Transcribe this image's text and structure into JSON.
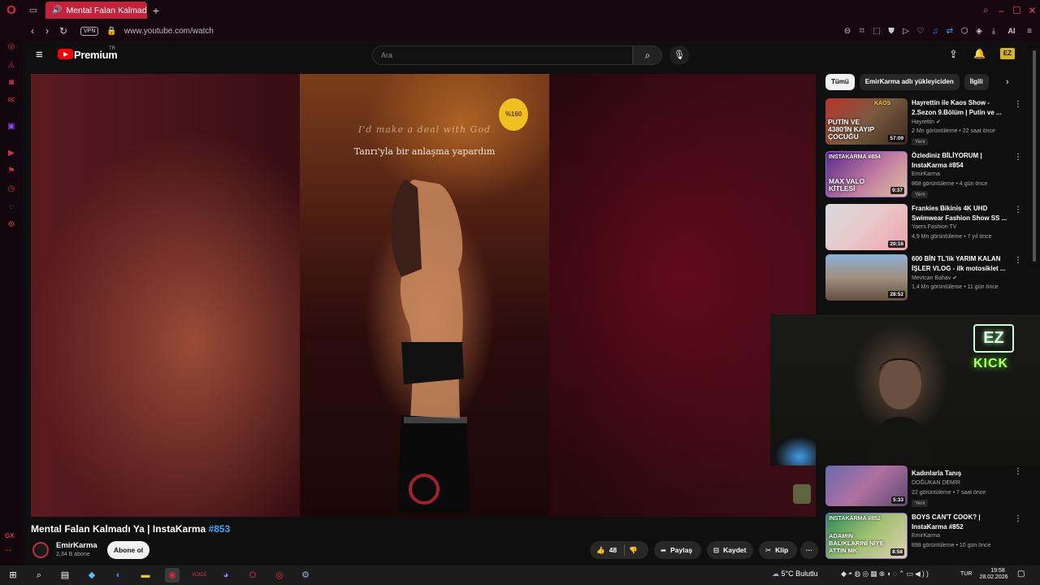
{
  "browser": {
    "tab_title": "Mental Falan Kalmadı Y",
    "url": "www.youtube.com/watch",
    "vpn_label": "VPN",
    "ai_label": "AI",
    "accent": "#c4213a"
  },
  "youtube": {
    "brand": "Premium",
    "brand_region": "TR",
    "search_placeholder": "Ara"
  },
  "video": {
    "lyric_en": "I'd make a deal with God",
    "lyric_tr": "Tanrı'yla bir anlaşma yapardım",
    "logo_badge": "%160",
    "title": "Mental Falan Kalmadı Ya | InstaKarma ",
    "hashtag": "#853",
    "channel": "EmirKarma",
    "subscribers": "2,34 B abone",
    "subscribe_label": "Abone ol",
    "likes": "48",
    "share_label": "Paylaş",
    "save_label": "Kaydet",
    "clip_label": "Klip"
  },
  "chips": [
    "Tümü",
    "EmirKarma adlı yükleyiciden",
    "İlgili"
  ],
  "recommendations": [
    {
      "title": "Hayrettin ile Kaos Show - 2.Sezon 9.Bölüm | Putin ve ...",
      "channel": "Hayrettin",
      "meta": "2 Mn görüntüleme • 22 saat önce",
      "new": "Yeni",
      "duration": "57:09",
      "thumb_top": "KAOS",
      "thumb_big": "PUTİN VE 4380'İN KAYIP ÇOCUĞU"
    },
    {
      "title": "Özlediniz BİLİYORUM | InstaKarma #854",
      "channel": "EmirKarma",
      "meta": "868 görüntüleme • 4 gün önce",
      "new": "Yeni",
      "duration": "9:37",
      "thumb_top": "INSTAKARMA #854",
      "thumb_big": "MAX VALO KİTLESİ"
    },
    {
      "title": "Frankies Bikinis 4K UHD Swimwear Fashion Show SS ...",
      "channel": "Yaers Fashion TV",
      "meta": "4,9 Mn görüntüleme • 7 yıl önce",
      "new": "",
      "duration": "20:16",
      "thumb_top": "",
      "thumb_big": ""
    },
    {
      "title": "600 BİN TL'lik YARIM KALAN İŞLER VLOG - ilk motosiklet ...",
      "channel": "Mevtcan Bahav",
      "meta": "1,4 Mn görüntüleme • 11 gün önce",
      "new": "",
      "duration": "28:52",
      "thumb_top": "",
      "thumb_big": ""
    },
    {
      "title": "Kadınlarla Tanış",
      "channel": "DOĞUKAN DEMİR",
      "meta": "22 görüntüleme • 7 saat önce",
      "new": "Yeni",
      "duration": "5:33",
      "thumb_top": "",
      "thumb_big": ""
    },
    {
      "title": "BOYS CAN'T COOK? | InstaKarma #852",
      "channel": "EmirKarma",
      "meta": "898 görüntüleme • 10 gün önce",
      "new": "",
      "duration": "8:58",
      "thumb_top": "INSTAKARMA #852",
      "thumb_big": "ADAMIN BALIKLARINI NİYE ATTIN MK"
    }
  ],
  "webcam": {
    "sign_ez": "EZ",
    "sign_kick": "KICK"
  },
  "taskbar": {
    "weather": "5°C  Bulutlu",
    "lang": "TUR",
    "time": "19:58",
    "date": "28.02.2026"
  }
}
